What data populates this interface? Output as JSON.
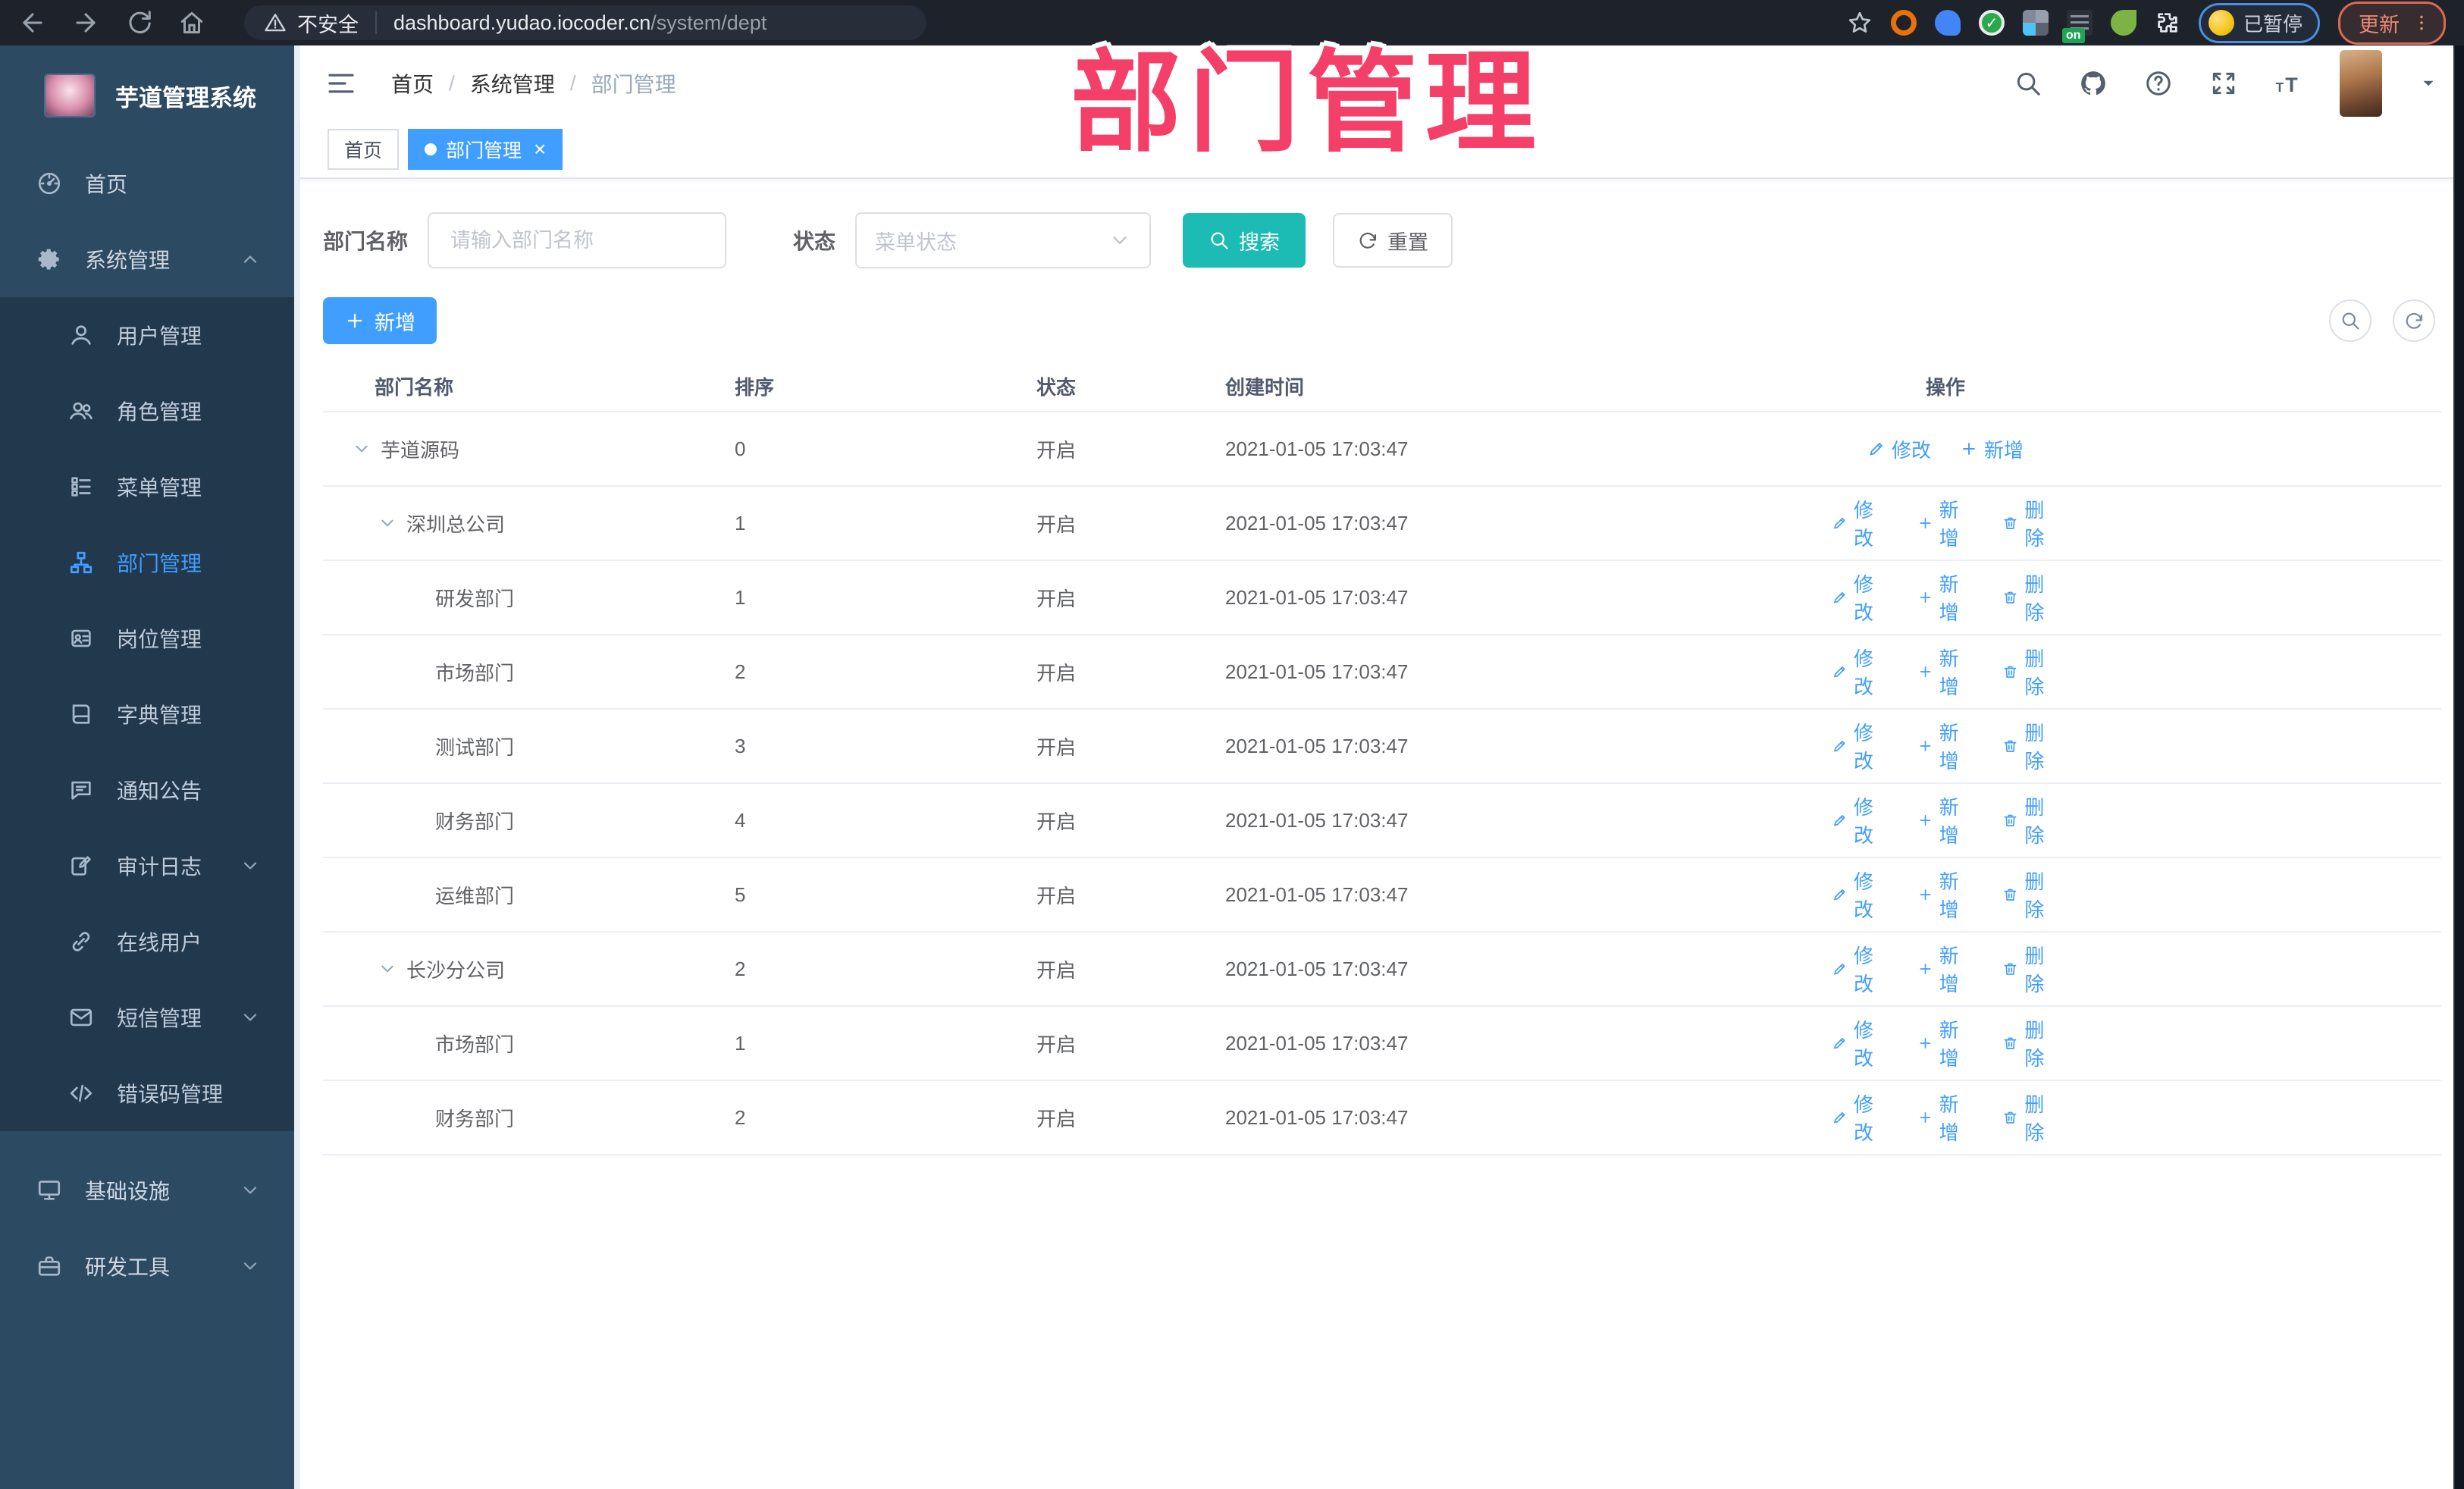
{
  "browser": {
    "nav_icons": [
      "back-icon",
      "forward-icon",
      "reload-icon",
      "home-icon"
    ],
    "security_icon": "warning-icon",
    "security_label": "不安全",
    "url_host": "dashboard.yudao.iocoder.cn",
    "url_path": "/system/dept",
    "bookmark_icon": "star-icon",
    "extensions": [
      {
        "name": "orange-ring-ext-icon",
        "kind": "ring-orange",
        "glyph": ""
      },
      {
        "name": "blue-drop-ext-icon",
        "kind": "dot-blue",
        "glyph": ""
      },
      {
        "name": "green-check-ext-icon",
        "kind": "check-green",
        "glyph": "✓"
      },
      {
        "name": "grid-ext-icon",
        "kind": "grid-grey",
        "glyph": ""
      },
      {
        "name": "list-on-ext-icon",
        "kind": "list-on",
        "glyph": "",
        "badge": "on"
      },
      {
        "name": "green-leaf-ext-icon",
        "kind": "dot-lightgreen",
        "glyph": ""
      },
      {
        "name": "puzzle-ext-icon",
        "kind": "puzzle-white",
        "glyph": ""
      }
    ],
    "paused_label": "已暂停",
    "update_label": "更新",
    "menu_icon": "kebab-menu-icon"
  },
  "overlay_title": "部门管理",
  "app_title": "芋道管理系统",
  "sidebar": {
    "items": [
      {
        "name": "home",
        "label": "首页",
        "icon": "dashboard-icon",
        "level": 0
      },
      {
        "name": "system-management",
        "label": "系统管理",
        "icon": "gear-icon",
        "level": 0,
        "chevron": "up"
      },
      {
        "name": "user-management",
        "label": "用户管理",
        "icon": "user-icon",
        "level": 1
      },
      {
        "name": "role-management",
        "label": "角色管理",
        "icon": "users-icon",
        "level": 1
      },
      {
        "name": "menu-management",
        "label": "菜单管理",
        "icon": "menu-list-icon",
        "level": 1
      },
      {
        "name": "dept-management",
        "label": "部门管理",
        "icon": "org-tree-icon",
        "level": 1,
        "active": true
      },
      {
        "name": "post-management",
        "label": "岗位管理",
        "icon": "badge-icon",
        "level": 1
      },
      {
        "name": "dict-management",
        "label": "字典管理",
        "icon": "dictionary-icon",
        "level": 1
      },
      {
        "name": "notice-announcement",
        "label": "通知公告",
        "icon": "announcement-icon",
        "level": 1
      },
      {
        "name": "audit-log",
        "label": "审计日志",
        "icon": "audit-log-icon",
        "level": 1,
        "chevron": "down"
      },
      {
        "name": "online-users",
        "label": "在线用户",
        "icon": "link-icon",
        "level": 1
      },
      {
        "name": "sms-management",
        "label": "短信管理",
        "icon": "sms-icon",
        "level": 1,
        "chevron": "down"
      },
      {
        "name": "error-code-management",
        "label": "错误码管理",
        "icon": "error-code-icon",
        "level": 1
      },
      {
        "name": "infrastructure",
        "label": "基础设施",
        "icon": "infrastructure-icon",
        "level": 0,
        "chevron": "down"
      },
      {
        "name": "dev-tools",
        "label": "研发工具",
        "icon": "dev-tools-icon",
        "level": 0,
        "chevron": "down"
      }
    ]
  },
  "topbar": {
    "hamburger_icon": "hamburger-icon",
    "breadcrumb": [
      "首页",
      "系统管理",
      "部门管理"
    ],
    "icons": [
      "search-icon",
      "github-icon",
      "help-icon",
      "fullscreen-icon",
      "font-size-icon"
    ],
    "avatar_icon": "user-avatar",
    "caret_icon": "caret-down-icon"
  },
  "tabs": [
    {
      "label": "首页",
      "active": false,
      "closable": false
    },
    {
      "label": "部门管理",
      "active": true,
      "closable": true
    }
  ],
  "filter": {
    "name_label": "部门名称",
    "name_placeholder": "请输入部门名称",
    "status_label": "状态",
    "status_placeholder": "菜单状态",
    "search_label": "搜索",
    "reset_label": "重置"
  },
  "toolbar": {
    "add_label": "新增"
  },
  "table": {
    "columns": [
      "部门名称",
      "排序",
      "状态",
      "创建时间",
      "操作"
    ],
    "action_labels": {
      "modify": "修改",
      "add": "新增",
      "delete": "删除"
    },
    "rows": [
      {
        "name": "芋道源码",
        "level": 0,
        "expanded": true,
        "sort": "0",
        "status": "开启",
        "created": "2021-01-05 17:03:47",
        "actions": [
          "modify",
          "add"
        ]
      },
      {
        "name": "深圳总公司",
        "level": 1,
        "expanded": true,
        "sort": "1",
        "status": "开启",
        "created": "2021-01-05 17:03:47",
        "actions": [
          "modify",
          "add",
          "delete"
        ]
      },
      {
        "name": "研发部门",
        "level": 2,
        "sort": "1",
        "status": "开启",
        "created": "2021-01-05 17:03:47",
        "actions": [
          "modify",
          "add",
          "delete"
        ]
      },
      {
        "name": "市场部门",
        "level": 2,
        "sort": "2",
        "status": "开启",
        "created": "2021-01-05 17:03:47",
        "actions": [
          "modify",
          "add",
          "delete"
        ]
      },
      {
        "name": "测试部门",
        "level": 2,
        "sort": "3",
        "status": "开启",
        "created": "2021-01-05 17:03:47",
        "actions": [
          "modify",
          "add",
          "delete"
        ]
      },
      {
        "name": "财务部门",
        "level": 2,
        "sort": "4",
        "status": "开启",
        "created": "2021-01-05 17:03:47",
        "actions": [
          "modify",
          "add",
          "delete"
        ]
      },
      {
        "name": "运维部门",
        "level": 2,
        "sort": "5",
        "status": "开启",
        "created": "2021-01-05 17:03:47",
        "actions": [
          "modify",
          "add",
          "delete"
        ]
      },
      {
        "name": "长沙分公司",
        "level": 1,
        "expanded": true,
        "sort": "2",
        "status": "开启",
        "created": "2021-01-05 17:03:47",
        "actions": [
          "modify",
          "add",
          "delete"
        ]
      },
      {
        "name": "市场部门",
        "level": 2,
        "sort": "1",
        "status": "开启",
        "created": "2021-01-05 17:03:47",
        "actions": [
          "modify",
          "add",
          "delete"
        ]
      },
      {
        "name": "财务部门",
        "level": 2,
        "sort": "2",
        "status": "开启",
        "created": "2021-01-05 17:03:47",
        "actions": [
          "modify",
          "add",
          "delete"
        ]
      }
    ]
  },
  "colors": {
    "primary": "#409eff",
    "search_button": "#1cbbb4",
    "sidebar_bg": "#2d4a63",
    "submenu_bg": "#22384d",
    "overlay_pink": "#f43f68"
  }
}
